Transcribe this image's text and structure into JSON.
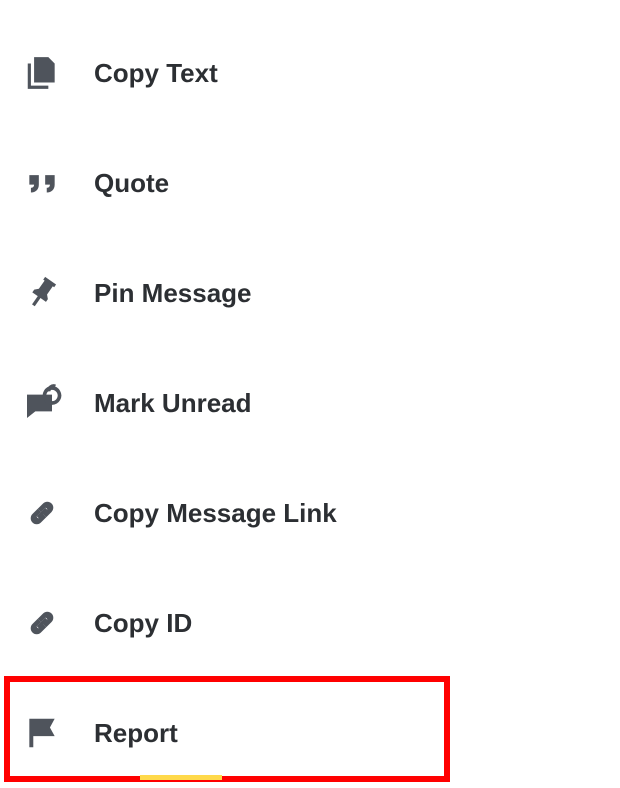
{
  "menu": {
    "copy_text": {
      "label": "Copy Text"
    },
    "quote": {
      "label": "Quote"
    },
    "pin_message": {
      "label": "Pin Message"
    },
    "mark_unread": {
      "label": "Mark Unread"
    },
    "copy_message_link": {
      "label": "Copy Message Link"
    },
    "copy_id": {
      "label": "Copy ID"
    },
    "report": {
      "label": "Report"
    }
  }
}
